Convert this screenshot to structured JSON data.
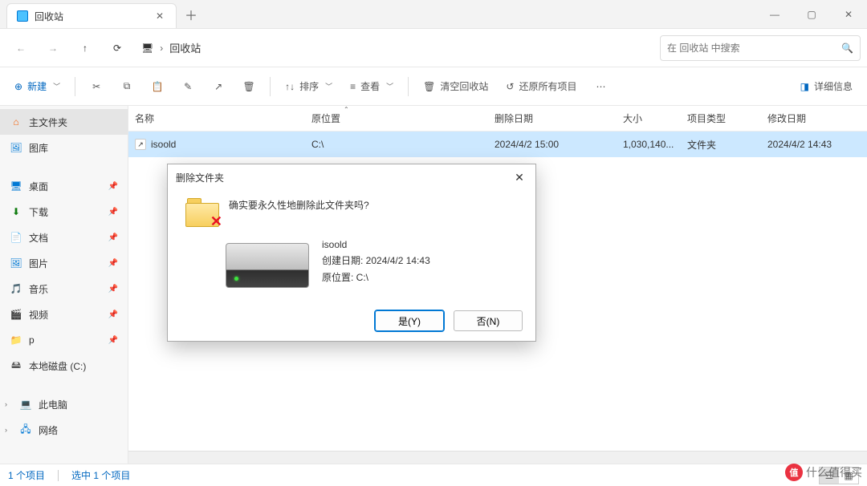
{
  "tab": {
    "title": "回收站"
  },
  "nav": {
    "breadcrumb": "回收站"
  },
  "search": {
    "placeholder": "在 回收站 中搜索"
  },
  "toolbar": {
    "new": "新建",
    "sort": "排序",
    "view": "查看",
    "empty": "清空回收站",
    "restore_all": "还原所有项目",
    "details": "详细信息"
  },
  "sidebar": {
    "home": "主文件夹",
    "gallery": "图库",
    "desktop": "桌面",
    "downloads": "下载",
    "documents": "文档",
    "pictures": "图片",
    "music": "音乐",
    "videos": "视频",
    "p": "p",
    "localdisk": "本地磁盘 (C:)",
    "thispc": "此电脑",
    "network": "网络"
  },
  "columns": {
    "name": "名称",
    "orig": "原位置",
    "deleted": "删除日期",
    "size": "大小",
    "type": "项目类型",
    "modified": "修改日期"
  },
  "row": {
    "name": "isoold",
    "orig": "C:\\",
    "deleted": "2024/4/2 15:00",
    "size": "1,030,140...",
    "type": "文件夹",
    "modified": "2024/4/2 14:43"
  },
  "dialog": {
    "title": "删除文件夹",
    "question": "确实要永久性地删除此文件夹吗?",
    "name": "isoold",
    "created_label": "创建日期: 2024/4/2 14:43",
    "orig_label": "原位置: C:\\",
    "yes": "是(Y)",
    "no": "否(N)"
  },
  "status": {
    "count": "1 个项目",
    "selected": "选中 1 个项目"
  },
  "watermark": "什么值得买"
}
